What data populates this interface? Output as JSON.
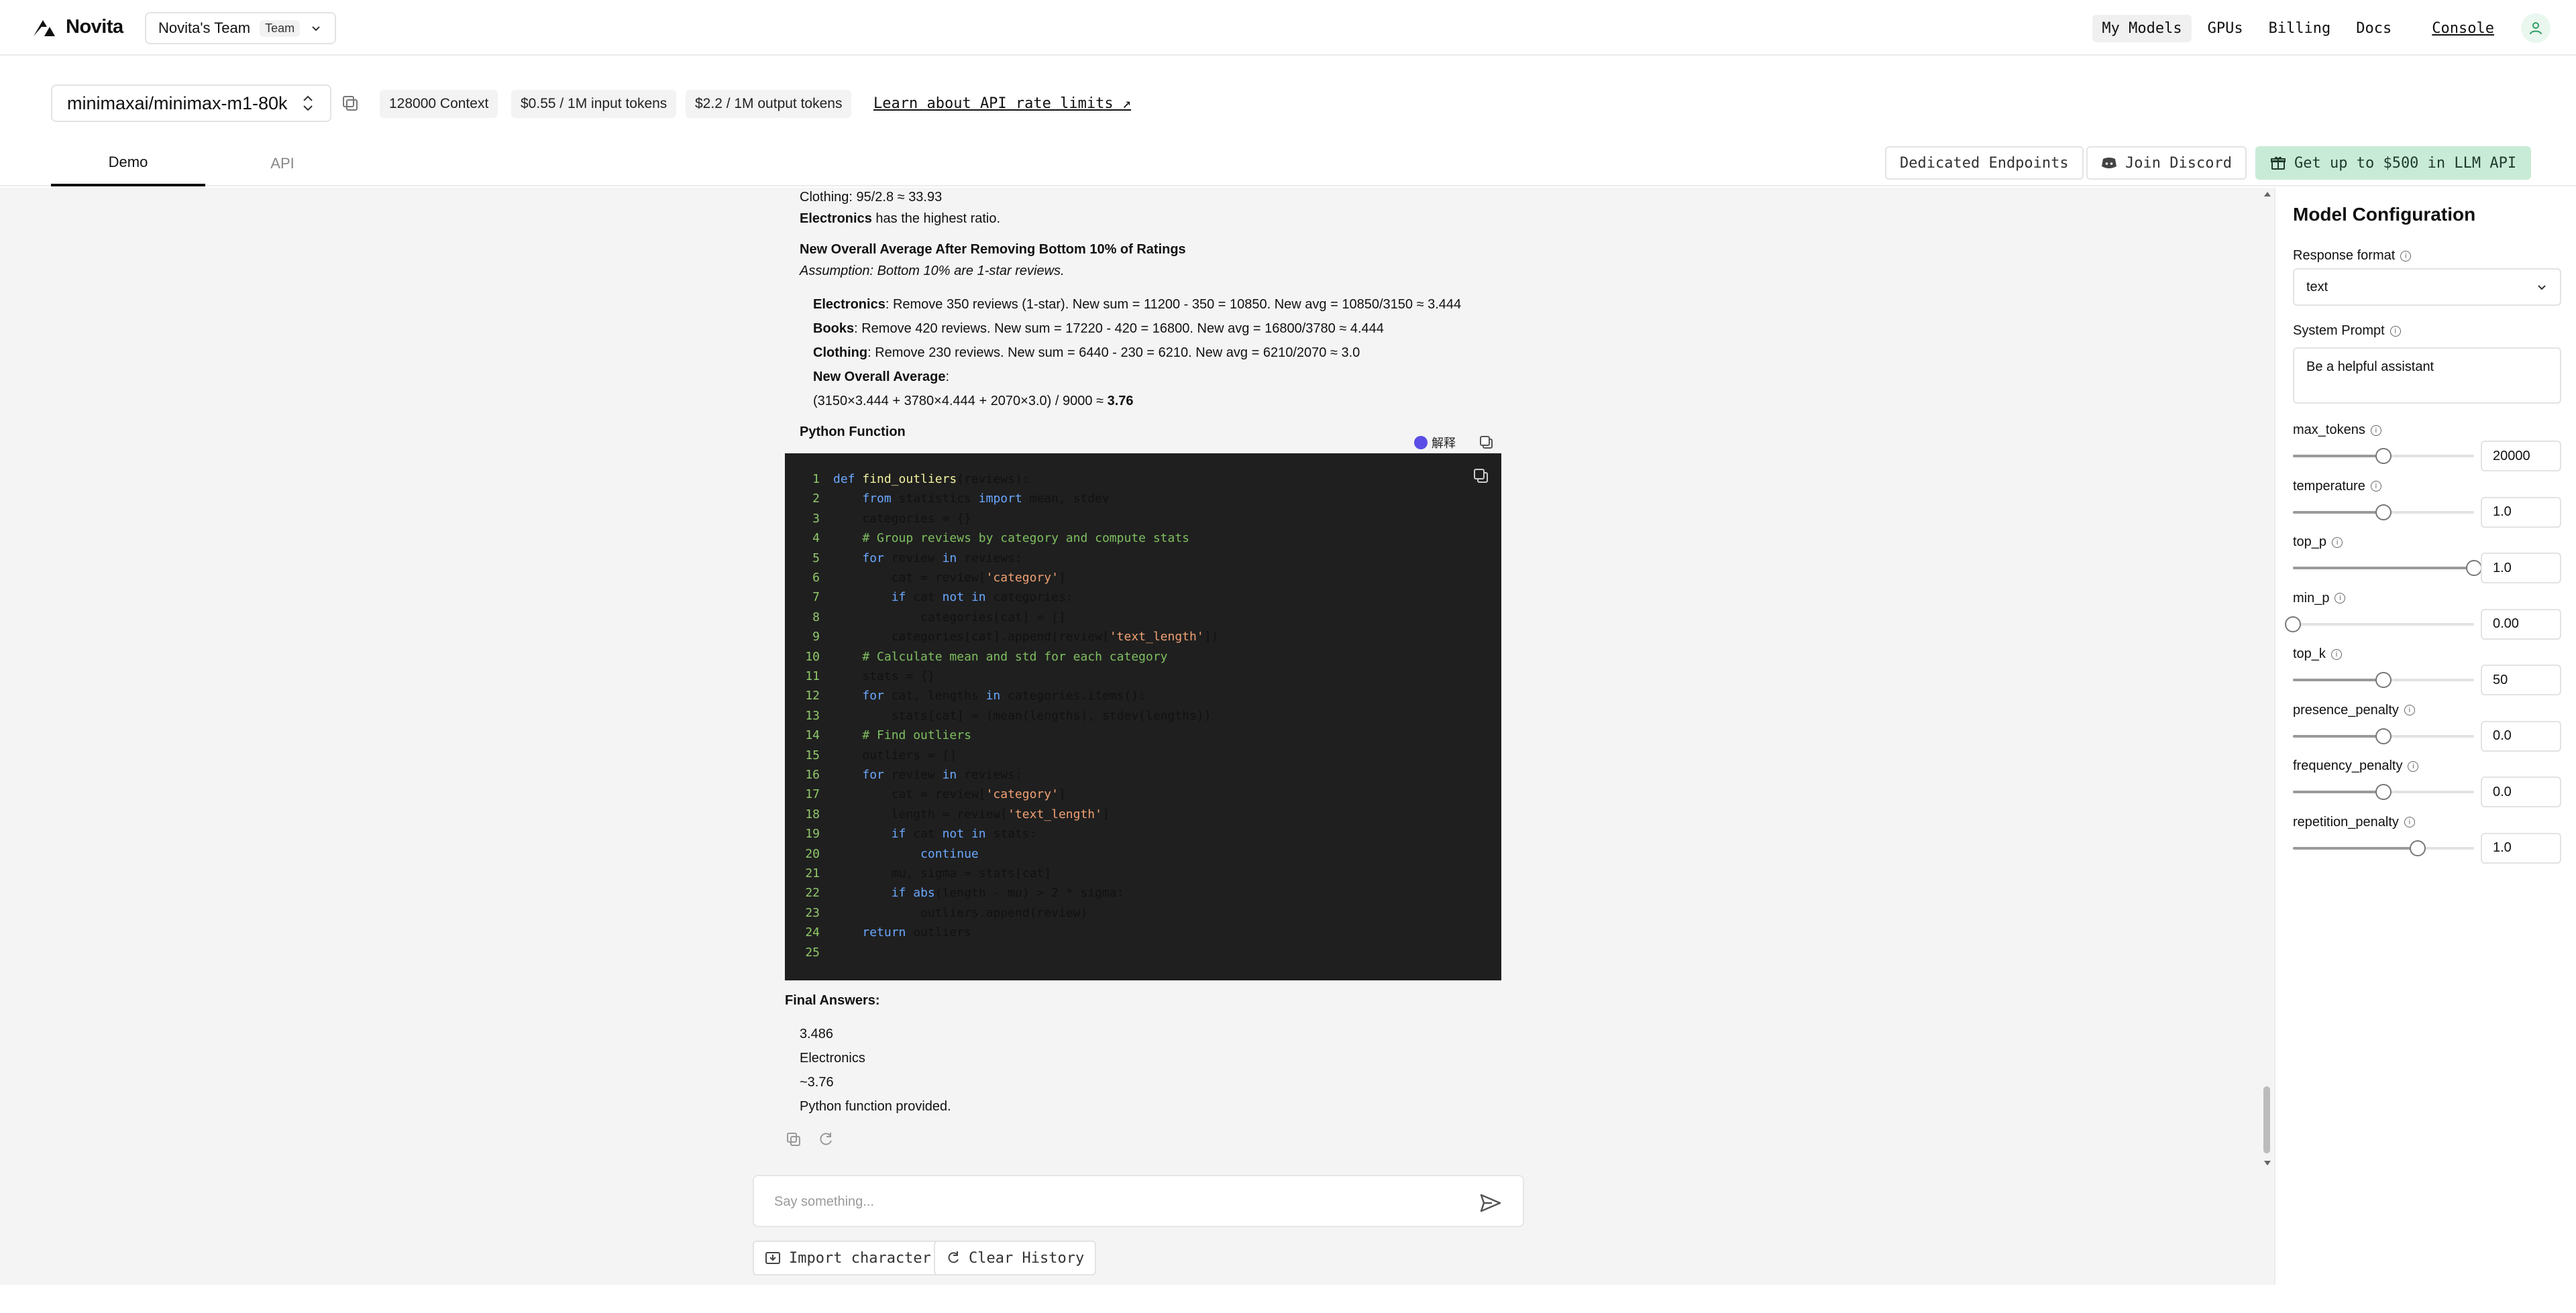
{
  "brand": {
    "name": "Novita"
  },
  "team": {
    "name": "Novita's Team",
    "badge": "Team"
  },
  "nav": {
    "items": [
      "My Models",
      "GPUs",
      "Billing",
      "Docs"
    ],
    "console": "Console"
  },
  "model": {
    "name": "minimaxai/minimax-m1-80k",
    "chips": [
      "128000 Context",
      "$0.55 / 1M input tokens",
      "$2.2 / 1M output tokens"
    ],
    "learn_link": "Learn about API rate limits ↗"
  },
  "tabs": [
    "Demo",
    "API"
  ],
  "actions": {
    "dedicated": "Dedicated Endpoints",
    "discord": "Join Discord",
    "promo": "Get up to $500 in LLM API"
  },
  "chat": {
    "lines": {
      "clothing_ratio": "Clothing: 95/2.8 ≈ 33.93",
      "highest_rest": " has the highest ratio.",
      "highest_strong": "Electronics",
      "new_avg_heading": "New Overall Average After Removing Bottom 10% of Ratings",
      "assumption": "Assumption: Bottom 10% are 1-star reviews.",
      "elec_strong": "Electronics",
      "elec_rest": ": Remove 350 reviews (1-star). New sum = 11200 - 350 = 10850. New avg = 10850/3150 ≈ 3.444",
      "books_strong": "Books",
      "books_rest": ": Remove 420 reviews. New sum = 17220 - 420 = 16800. New avg = 16800/3780 ≈ 4.444",
      "cloth_strong": "Clothing",
      "cloth_rest": ": Remove 230 reviews. New sum = 6440 - 230 = 6210. New avg = 6210/2070 ≈ 3.0",
      "overall_strong": "New Overall Average",
      "overall_colon": ":",
      "formula": "(3150×3.444 + 3780×4.444 + 2070×3.0) / 9000 ≈ ",
      "formula_result": "3.76",
      "python_heading": "Python Function",
      "explain": "解释",
      "final_heading": "Final Answers:",
      "ans1": "3.486",
      "ans2": "Electronics",
      "ans3": "~3.76",
      "ans4": "Python function provided."
    },
    "code": [
      "def find_outliers(reviews):",
      "    from statistics import mean, stdev",
      "    categories = {}",
      "    # Group reviews by category and compute stats",
      "    for review in reviews:",
      "        cat = review['category']",
      "        if cat not in categories:",
      "            categories[cat] = []",
      "        categories[cat].append(review['text_length'])",
      "    # Calculate mean and std for each category",
      "    stats = {}",
      "    for cat, lengths in categories.items():",
      "        stats[cat] = (mean(lengths), stdev(lengths))",
      "    # Find outliers",
      "    outliers = []",
      "    for review in reviews:",
      "        cat = review['category']",
      "        length = review['text_length']",
      "        if cat not in stats:",
      "            continue",
      "        mu, sigma = stats[cat]",
      "        if abs(length - mu) > 2 * sigma:",
      "            outliers.append(review)",
      "    return outliers",
      ""
    ],
    "input_placeholder": "Say something...",
    "import_btn": "Import character",
    "clear_btn": "Clear History"
  },
  "config": {
    "title": "Model Configuration",
    "response_format_label": "Response format",
    "response_format_value": "text",
    "system_prompt_label": "System Prompt",
    "system_prompt_value": "Be a helpful assistant",
    "params": [
      {
        "name": "max_tokens",
        "value": "20000",
        "level": 0.5
      },
      {
        "name": "temperature",
        "value": "1.0",
        "level": 0.5
      },
      {
        "name": "top_p",
        "value": "1.0",
        "level": 1.0
      },
      {
        "name": "min_p",
        "value": "0.00",
        "level": 0.0
      },
      {
        "name": "top_k",
        "value": "50",
        "level": 0.5
      },
      {
        "name": "presence_penalty",
        "value": "0.0",
        "level": 0.5
      },
      {
        "name": "frequency_penalty",
        "value": "0.0",
        "level": 0.5
      },
      {
        "name": "repetition_penalty",
        "value": "1.0",
        "level": 0.69
      }
    ]
  },
  "colors": {
    "promo_bg": "#c8ebd7",
    "code_bg": "#1f1f1f",
    "chat_bg": "#f4f4f4"
  }
}
